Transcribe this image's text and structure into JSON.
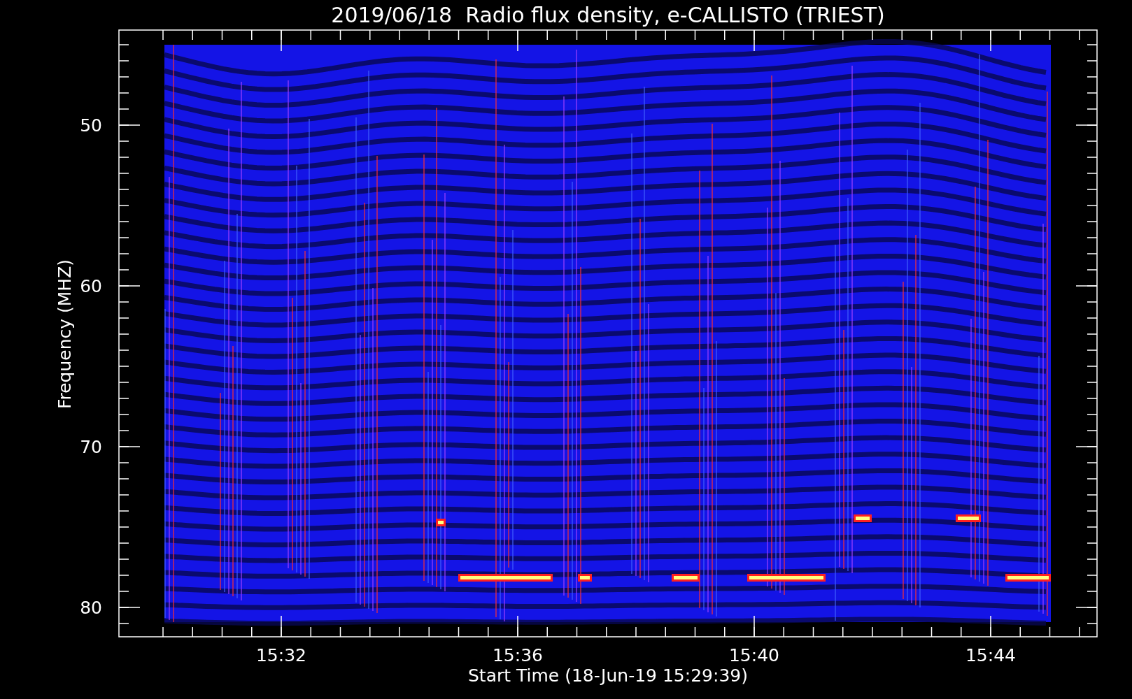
{
  "title": "2019/06/18  Radio flux density, e-CALLISTO (TRIEST)",
  "y_axis": {
    "label": "Frequency (MHZ)",
    "ticks": [
      "50",
      "60",
      "70",
      "80"
    ]
  },
  "x_axis": {
    "label": "Start Time (18-Jun-19 15:29:39)",
    "ticks": [
      "15:32",
      "15:36",
      "15:40",
      "15:44"
    ]
  }
}
